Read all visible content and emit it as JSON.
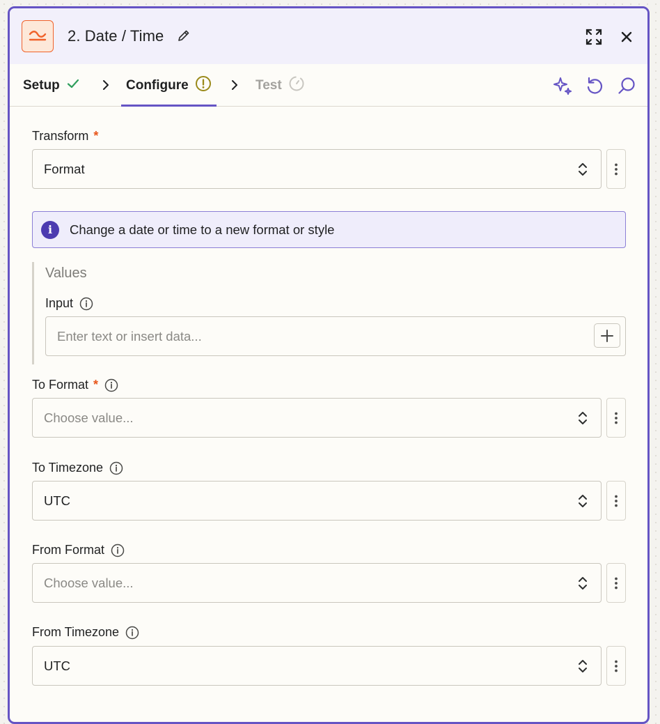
{
  "header": {
    "title": "2. Date / Time",
    "app_icon": "formatter-icon",
    "expand_icon": "expand-icon",
    "close_icon": "close-icon",
    "edit_icon": "pencil-icon"
  },
  "tabs": [
    {
      "label": "Setup",
      "status": "complete",
      "icon": "check-icon"
    },
    {
      "label": "Configure",
      "status": "warning",
      "icon": "warning-icon"
    },
    {
      "label": "Test",
      "status": "disabled",
      "icon": "timer-icon"
    }
  ],
  "toolbar": {
    "icons": [
      "ai-sparkle-icon",
      "reset-icon",
      "search-icon"
    ]
  },
  "form": {
    "transform": {
      "label": "Transform",
      "required": "*",
      "value": "Format"
    },
    "info_message": "Change a date or time to a new format or style",
    "values": {
      "title": "Values",
      "input_label": "Input",
      "input_placeholder": "Enter text or insert data..."
    },
    "to_format": {
      "label": "To Format",
      "required": "*",
      "placeholder": "Choose value..."
    },
    "to_timezone": {
      "label": "To Timezone",
      "value": "UTC"
    },
    "from_format": {
      "label": "From Format",
      "placeholder": "Choose value..."
    },
    "from_timezone": {
      "label": "From Timezone",
      "value": "UTC"
    }
  },
  "colors": {
    "accent": "#6554c4",
    "brand_orange": "#f0622a",
    "success": "#2f9e5c",
    "warning": "#9a8a1a"
  }
}
